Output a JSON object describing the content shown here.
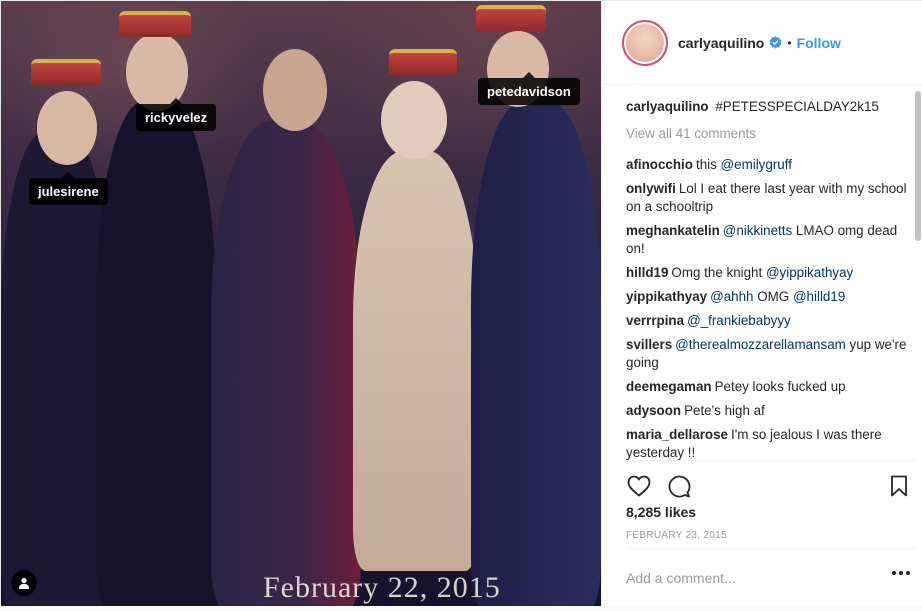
{
  "photo": {
    "date_overlay": "February 22, 2015",
    "tags": [
      {
        "name": "julesirene"
      },
      {
        "name": "rickyvelez"
      },
      {
        "name": "petedavidson"
      }
    ]
  },
  "header": {
    "username": "carlyaquilino",
    "separator": "•",
    "follow_label": "Follow"
  },
  "caption": {
    "username": "carlyaquilino",
    "text": "#PETESSPECIALDAY2k15"
  },
  "view_all_label": "View all 41 comments",
  "comments": [
    {
      "user": "afinocchio",
      "parts": [
        {
          "t": "this "
        },
        {
          "t": "@emilygruff",
          "m": true
        }
      ]
    },
    {
      "user": "onlywifi",
      "parts": [
        {
          "t": "Lol I eat there last year with my school on a schooltrip"
        }
      ]
    },
    {
      "user": "meghankatelin",
      "parts": [
        {
          "t": "@nikkinetts",
          "m": true
        },
        {
          "t": " LMAO omg dead on!"
        }
      ]
    },
    {
      "user": "hilld19",
      "parts": [
        {
          "t": "Omg the knight "
        },
        {
          "t": "@yippikathyay",
          "m": true
        }
      ]
    },
    {
      "user": "yippikathyay",
      "parts": [
        {
          "t": "@ahhh",
          "m": true
        },
        {
          "t": " OMG "
        },
        {
          "t": "@hilld19",
          "m": true
        }
      ]
    },
    {
      "user": "verrrpina",
      "parts": [
        {
          "t": "@_frankiebabyyy",
          "m": true
        }
      ]
    },
    {
      "user": "svillers",
      "parts": [
        {
          "t": "@therealmozzarellamansam",
          "m": true
        },
        {
          "t": " yup we're going"
        }
      ]
    },
    {
      "user": "deemegaman",
      "parts": [
        {
          "t": "Petey looks fucked up"
        }
      ]
    },
    {
      "user": "adysoon",
      "parts": [
        {
          "t": "Pete's high af"
        }
      ]
    },
    {
      "user": "maria_dellarose",
      "parts": [
        {
          "t": "I'm so jealous I was there yesterday !!"
        }
      ]
    }
  ],
  "likes": "8,285 likes",
  "post_date": "FEBRUARY 23, 2015",
  "add_comment_placeholder": "Add a comment...",
  "colors": {
    "link": "#3897f0",
    "mention": "#003569",
    "muted": "#999999"
  },
  "icons": [
    "heart-icon",
    "comment-icon",
    "bookmark-icon",
    "verified-badge-icon",
    "more-options-icon",
    "user-tag-icon"
  ]
}
